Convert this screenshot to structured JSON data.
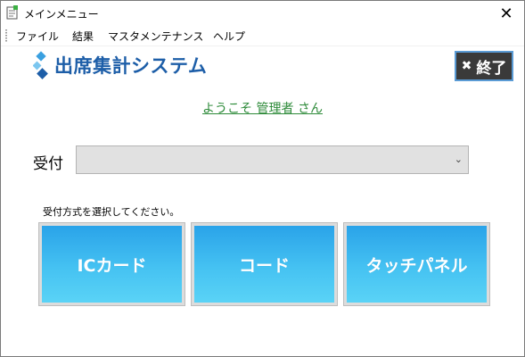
{
  "window": {
    "title": "メインメニュー",
    "close_glyph": "✕"
  },
  "menu": {
    "items": [
      {
        "label": "ファイル"
      },
      {
        "label": "結果"
      },
      {
        "label": "マスタメンテナンス"
      },
      {
        "label": "ヘルプ"
      }
    ]
  },
  "header": {
    "logo_text": "出席集計システム",
    "logo_color": "#1d5ea8",
    "exit_label": "終了",
    "exit_icon": "close-icon"
  },
  "welcome": {
    "text": "ようこそ 管理者 さん",
    "color": "#2e8b3a"
  },
  "reception": {
    "label": "受付",
    "selected_value": "",
    "instruction": "受付方式を選択してください。"
  },
  "buttons": {
    "ic_card": "ICカード",
    "code": "コード",
    "touch_panel": "タッチパネル",
    "accent_color": "#45c2f2"
  }
}
